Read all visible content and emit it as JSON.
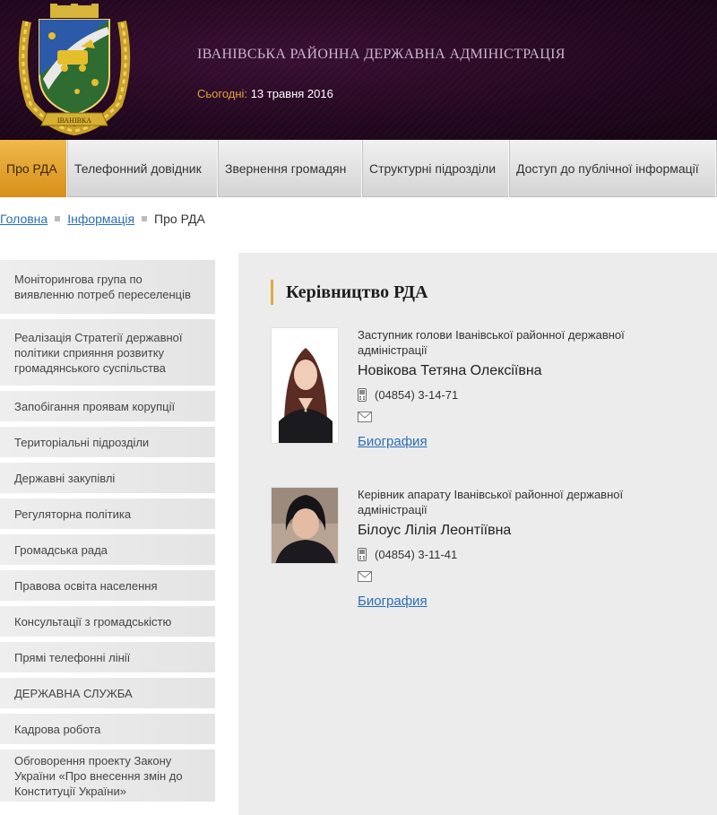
{
  "header": {
    "title": "ІВАНІВСЬКА РАЙОННА ДЕРЖАВНА АДМІНІСТРАЦІЯ",
    "today_label": "Сьогодні:",
    "today_value": "13 травня 2016",
    "coat_banner_text": "ІВАНІВКА"
  },
  "nav": {
    "items": [
      {
        "label": "Про РДА"
      },
      {
        "label": "Телефонний довідник"
      },
      {
        "label": "Звернення громадян"
      },
      {
        "label": "Структурні підрозділи"
      },
      {
        "label": "Доступ до публічної інформації"
      }
    ]
  },
  "breadcrumb": {
    "home": "Головна",
    "info": "Інформація",
    "current": "Про РДА"
  },
  "sidebar": {
    "items": [
      {
        "label": "Моніторингова група по виявленню потреб переселенців"
      },
      {
        "label": "Реалізація Стратегії державної політики сприяння розвитку громадянського суспільства"
      },
      {
        "label": "Запобігання проявам корупції"
      },
      {
        "label": "Територіальні підрозділи"
      },
      {
        "label": "Державні закупівлі"
      },
      {
        "label": "Регуляторна політика"
      },
      {
        "label": "Громадська рада"
      },
      {
        "label": "Правова освіта населення"
      },
      {
        "label": "Консультації з громадськістю"
      },
      {
        "label": "Прямі телефонні лінії"
      },
      {
        "label": "ДЕРЖАВНА СЛУЖБА"
      },
      {
        "label": "Кадрова робота"
      },
      {
        "label": "Обговорення проекту Закону України «Про внесення змін до Конституції України»"
      }
    ]
  },
  "content": {
    "title": "Керівництво РДА",
    "people": [
      {
        "position": "Заступник голови Іванівської районної державної адміністрації",
        "name": "Новікова Тетяна Олексіївна",
        "phone": "(04854) 3-14-71",
        "bio_link": "Биография"
      },
      {
        "position": "Керівник апарату Іванівської районної державної адміністрації",
        "name": "Білоус Лілія Леонтіївна",
        "phone": "(04854) 3-11-41",
        "bio_link": "Биография"
      }
    ]
  },
  "colors": {
    "accent": "#e2a83c",
    "link": "#2c6eb3",
    "header_bg": "#240820"
  }
}
